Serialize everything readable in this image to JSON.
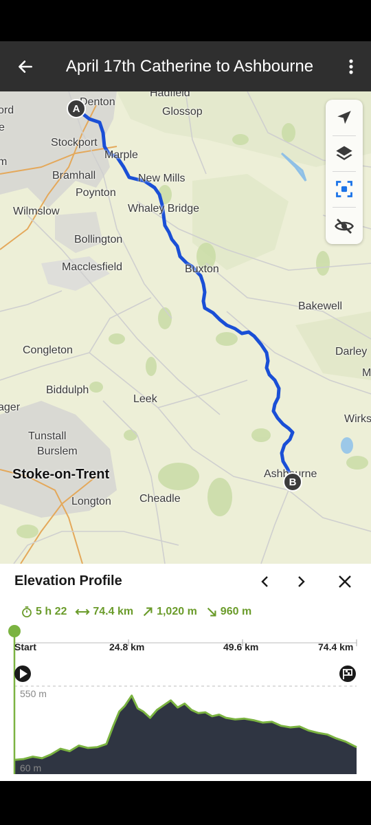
{
  "header": {
    "title": "April 17th Catherine to Ashbourne",
    "back_icon": "arrow-left-icon",
    "menu_icon": "more-vertical-icon"
  },
  "map": {
    "places": [
      {
        "id": "denton",
        "label": "Denton"
      },
      {
        "id": "hadfield",
        "label": "Hadfield"
      },
      {
        "id": "glossop",
        "label": "Glossop"
      },
      {
        "id": "ord",
        "label": "ord"
      },
      {
        "id": "e",
        "label": "e"
      },
      {
        "id": "stockport",
        "label": "Stockport"
      },
      {
        "id": "marple",
        "label": "Marple"
      },
      {
        "id": "m",
        "label": "m"
      },
      {
        "id": "bramhall",
        "label": "Bramhall"
      },
      {
        "id": "newmills",
        "label": "New Mills"
      },
      {
        "id": "poynton",
        "label": "Poynton"
      },
      {
        "id": "wilmslow",
        "label": "Wilmslow"
      },
      {
        "id": "whaleybridge",
        "label": "Whaley Bridge"
      },
      {
        "id": "bollington",
        "label": "Bollington"
      },
      {
        "id": "macclesfield",
        "label": "Macclesfield"
      },
      {
        "id": "buxton",
        "label": "Buxton"
      },
      {
        "id": "bakewell",
        "label": "Bakewell"
      },
      {
        "id": "congleton",
        "label": "Congleton"
      },
      {
        "id": "darley",
        "label": "Darley"
      },
      {
        "id": "darleym",
        "label": "M"
      },
      {
        "id": "biddulph",
        "label": "Biddulph"
      },
      {
        "id": "leek",
        "label": "Leek"
      },
      {
        "id": "ager",
        "label": "ager"
      },
      {
        "id": "wirks",
        "label": "Wirks"
      },
      {
        "id": "tunstall",
        "label": "Tunstall"
      },
      {
        "id": "burslem",
        "label": "Burslem"
      },
      {
        "id": "stoke",
        "label": "Stoke-on-Trent"
      },
      {
        "id": "ashbourne",
        "label": "Ashbourne"
      },
      {
        "id": "longton",
        "label": "Longton"
      },
      {
        "id": "cheadle",
        "label": "Cheadle"
      }
    ],
    "start_marker": "A",
    "end_marker": "B",
    "route_color": "#1a4fd6",
    "controls": [
      {
        "id": "locate",
        "icon": "navigation-arrow-icon"
      },
      {
        "id": "layers",
        "icon": "layers-icon"
      },
      {
        "id": "fit",
        "icon": "focus-frame-icon"
      },
      {
        "id": "hide",
        "icon": "eye-off-icon"
      }
    ]
  },
  "elevation_panel": {
    "title": "Elevation Profile",
    "prev_icon": "chevron-left-icon",
    "next_icon": "chevron-right-icon",
    "close_icon": "close-icon",
    "stats": {
      "duration": "5 h 22",
      "distance": "74.4 km",
      "ascent": "1,020 m",
      "descent": "960 m"
    },
    "accent_color": "#7bb341"
  },
  "chart_data": {
    "type": "area",
    "x_ticks": [
      "Start",
      "24.8 km",
      "49.6 km",
      "74.4 km"
    ],
    "y_labels": [
      "550 m",
      "60 m"
    ],
    "xlim": [
      0,
      74.4
    ],
    "ylim": [
      60,
      550
    ],
    "series": [
      {
        "x": [
          0,
          2,
          4,
          6,
          8,
          10,
          12,
          14,
          16,
          18,
          20,
          21.5,
          22.8,
          24,
          25.5,
          26.8,
          28,
          29.5,
          31,
          32.5,
          34,
          35.5,
          37,
          38.5,
          40,
          41.5,
          43,
          44.5,
          46,
          48,
          50,
          52,
          54,
          56,
          58,
          60,
          62,
          64,
          66,
          68,
          70,
          72,
          74.4
        ],
        "y": [
          85,
          90,
          105,
          95,
          120,
          155,
          140,
          175,
          160,
          165,
          185,
          300,
          390,
          425,
          490,
          410,
          390,
          350,
          400,
          430,
          460,
          415,
          440,
          400,
          380,
          385,
          360,
          370,
          350,
          340,
          345,
          335,
          320,
          325,
          300,
          290,
          295,
          270,
          255,
          245,
          220,
          200,
          165
        ]
      }
    ]
  }
}
